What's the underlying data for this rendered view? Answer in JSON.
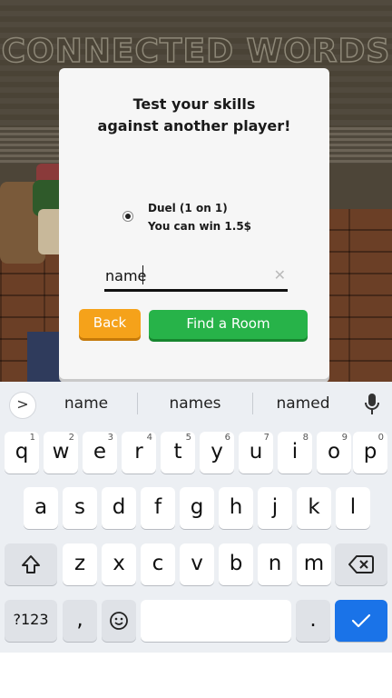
{
  "game": {
    "title": "CONNECTED WORDS"
  },
  "modal": {
    "title_line1": "Test your skills",
    "title_line2": "against another player!",
    "option": {
      "line1": "Duel (1 on 1)",
      "line2": "You can win 1.5$",
      "selected": true
    },
    "name_input": {
      "value": "name",
      "clear_icon": "close-icon"
    },
    "back_label": "Back",
    "find_label": "Find a Room",
    "colors": {
      "back": "#f5a21a",
      "find": "#27b349"
    }
  },
  "keyboard": {
    "suggestions": [
      "name",
      "names",
      "named"
    ],
    "expand_glyph": ">",
    "row1": [
      {
        "key": "q",
        "hint": "1"
      },
      {
        "key": "w",
        "hint": "2"
      },
      {
        "key": "e",
        "hint": "3"
      },
      {
        "key": "r",
        "hint": "4"
      },
      {
        "key": "t",
        "hint": "5"
      },
      {
        "key": "y",
        "hint": "6"
      },
      {
        "key": "u",
        "hint": "7"
      },
      {
        "key": "i",
        "hint": "8"
      },
      {
        "key": "o",
        "hint": "9"
      },
      {
        "key": "p",
        "hint": "0"
      }
    ],
    "row2": [
      "a",
      "s",
      "d",
      "f",
      "g",
      "h",
      "j",
      "k",
      "l"
    ],
    "row3": [
      "z",
      "x",
      "c",
      "v",
      "b",
      "n",
      "m"
    ],
    "symbols_label": "?123",
    "comma": ",",
    "period": ".",
    "done_color": "#1a73e8"
  }
}
